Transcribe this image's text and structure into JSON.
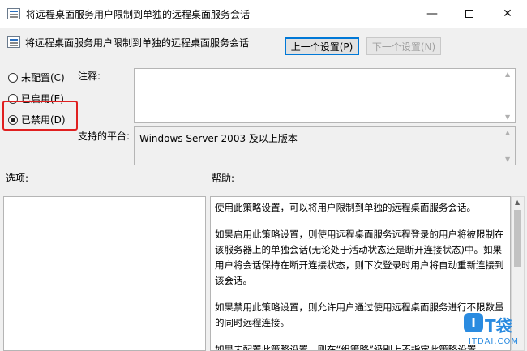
{
  "window": {
    "title": "将远程桌面服务用户限制到单独的远程桌面服务会话",
    "icons": {
      "app": "policy-icon",
      "minimize": "minimize-icon",
      "maximize": "maximize-icon",
      "close": "close-icon"
    },
    "minimize_glyph": "—",
    "close_glyph": "✕"
  },
  "header": {
    "policy_name": "将远程桌面服务用户限制到单独的远程桌面服务会话",
    "prev_button": "上一个设置(P)",
    "next_button": "下一个设置(N)"
  },
  "state": {
    "options": [
      {
        "label": "未配置(C)",
        "selected": false
      },
      {
        "label": "已启用(E)",
        "selected": false
      },
      {
        "label": "已禁用(D)",
        "selected": true
      }
    ],
    "highlight_color": "#e02020"
  },
  "comment": {
    "label": "注释:",
    "value": ""
  },
  "platform": {
    "label": "支持的平台:",
    "value": "Windows Server 2003 及以上版本"
  },
  "options_panel": {
    "label": "选项:"
  },
  "help_panel": {
    "label": "帮助:",
    "paragraphs": [
      "使用此策略设置，可以将用户限制到单独的远程桌面服务会话。",
      "如果启用此策略设置，则使用远程桌面服务远程登录的用户将被限制在该服务器上的单独会话(无论处于活动状态还是断开连接状态)中。如果用户将会话保持在断开连接状态，则下次登录时用户将自动重新连接到该会话。",
      "如果禁用此策略设置，则允许用户通过使用远程桌面服务进行不限数量的同时远程连接。",
      "如果未配置此策略设置，则在“组策略”级别上不指定此策略设置。"
    ]
  },
  "watermark": {
    "mark": "I",
    "text": "T袋",
    "sub": "ITDAI.COM"
  }
}
